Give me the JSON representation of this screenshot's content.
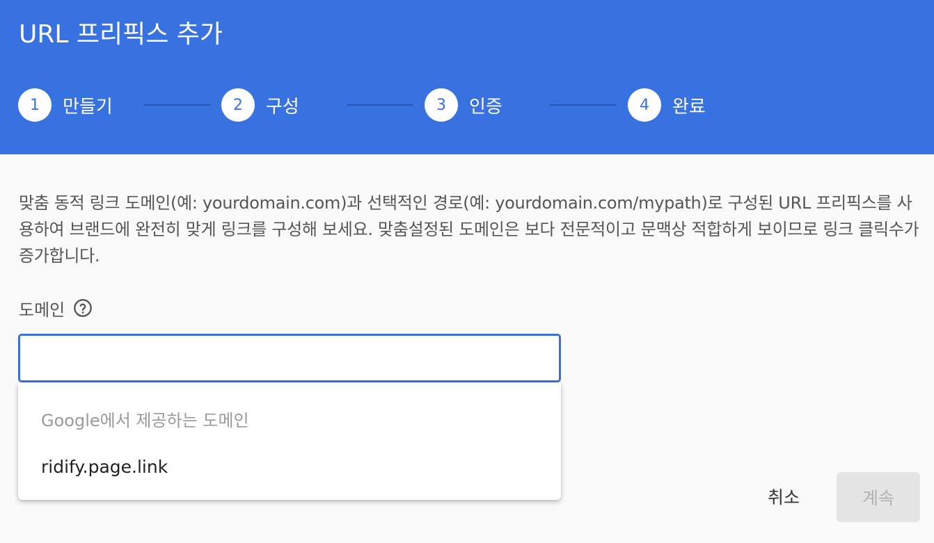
{
  "header": {
    "title": "URL 프리픽스 추가",
    "steps": [
      {
        "number": "1",
        "label": "만들기"
      },
      {
        "number": "2",
        "label": "구성"
      },
      {
        "number": "3",
        "label": "인증"
      },
      {
        "number": "4",
        "label": "완료"
      }
    ]
  },
  "main": {
    "description": "맞춤 동적 링크 도메인(예: yourdomain.com)과 선택적인 경로(예: yourdomain.com/mypath)로 구성된 URL 프리픽스를 사용하여 브랜드에 완전히 맞게 링크를 구성해 보세요. 맞춤설정된 도메인은 보다 전문적이고 문맥상 적합하게 보이므로 링크 클릭수가 증가합니다.",
    "domain_field": {
      "label": "도메인",
      "help_icon": "help-circle-icon",
      "value": "",
      "placeholder": ""
    },
    "dropdown": {
      "header": "Google에서 제공하는 도메인",
      "options": [
        "ridify.page.link"
      ]
    }
  },
  "actions": {
    "cancel_label": "취소",
    "continue_label": "계속"
  },
  "colors": {
    "header_bg": "#3871e0",
    "input_border": "#3a70d8",
    "disabled_button_bg": "#e5e5e5"
  }
}
